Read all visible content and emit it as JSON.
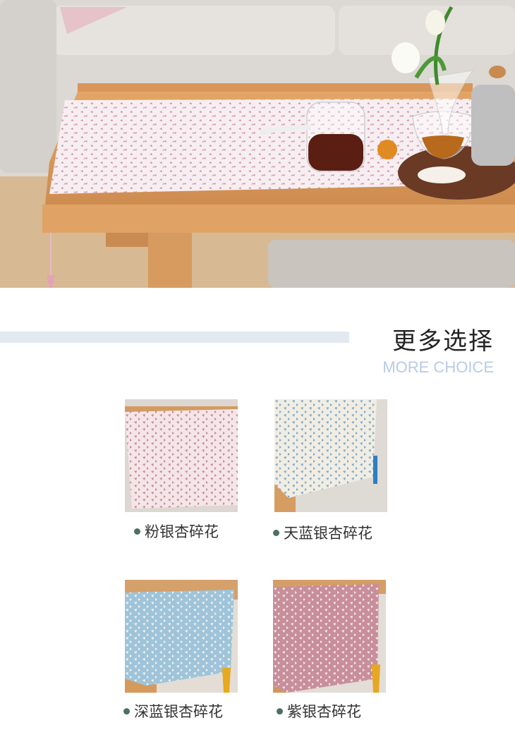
{
  "section": {
    "title_cn": "更多选择",
    "title_en": "MORE CHOICE"
  },
  "products": [
    {
      "label": "粉银杏碎花",
      "color": "#e8c9cf"
    },
    {
      "label": "天蓝银杏碎花",
      "color": "#8fb7d6"
    },
    {
      "label": "深蓝银杏碎花",
      "color": "#9cc2d9"
    },
    {
      "label": "紫银杏碎花",
      "color": "#c88e9c"
    }
  ]
}
